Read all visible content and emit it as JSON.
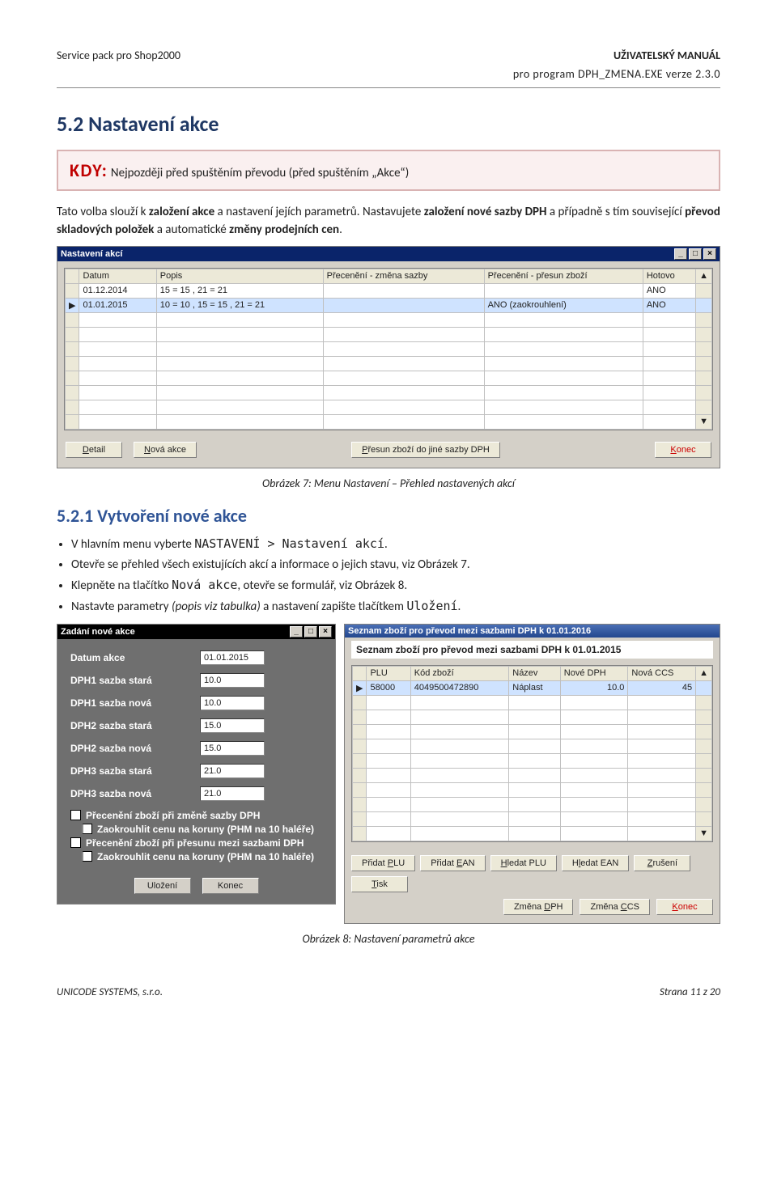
{
  "header": {
    "left": "Service pack pro Shop2000",
    "right_bold": "UŽIVATELSKÝ MANUÁL",
    "right_sub": "pro program DPH_ZMENA.EXE verze 2.3.0"
  },
  "h2": "5.2 Nastavení akce",
  "kdy": {
    "label": "KDY:",
    "text": "Nejpozději před spuštěním převodu (před spuštěním „Akce“)"
  },
  "para1_a": "Tato volba slouží k ",
  "para1_b": "založení akce",
  "para1_c": " a nastavení jejích parametrů. Nastavujete ",
  "para1_d": "založení nové sazby DPH",
  "para1_e": " a případně s tím související ",
  "para1_f": "převod skladových položek",
  "para1_g": " a automatické ",
  "para1_h": "změny prodejních cen",
  "para1_i": ".",
  "win1": {
    "title": "Nastavení akcí",
    "cols": [
      "Datum",
      "Popis",
      "Přecenění - změna sazby",
      "Přecenění - přesun zboží",
      "Hotovo"
    ],
    "rows": [
      {
        "datum": "01.12.2014",
        "popis": "15 = 15 , 21 = 21",
        "c3": "",
        "c4": "",
        "c5": "ANO"
      },
      {
        "datum": "01.01.2015",
        "popis": "10 = 10 , 15 = 15 , 21 = 21",
        "c3": "",
        "c4": "ANO (zaokrouhlení)",
        "c5": "ANO"
      }
    ],
    "btn_detail": "Detail",
    "btn_nova": "Nová akce",
    "btn_presun": "Přesun zboží do jiné sazby DPH",
    "btn_konec": "Konec"
  },
  "caption1": "Obrázek 7: Menu Nastavení – Přehled nastavených akcí",
  "h3": "5.2.1 Vytvoření nové akce",
  "bullets": [
    {
      "a": "V hlavním menu vyberte ",
      "m": "NASTAVENÍ > Nastavení akcí",
      "b": "."
    },
    {
      "a": "Otevře se přehled všech existujících akcí a informace o jejich stavu, viz Obrázek 7.",
      "m": "",
      "b": ""
    },
    {
      "a": "Klepněte na tlačítko ",
      "m": "Nová akce",
      "b": ", otevře se formulář, viz Obrázek 8."
    },
    {
      "a": "Nastavte parametry ",
      "i": "(popis viz tabulka)",
      "b": " a nastavení zapište tlačítkem ",
      "m": "Uložení",
      "c": "."
    }
  ],
  "form": {
    "title": "Zadání nové akce",
    "rows": [
      {
        "l": "Datum akce",
        "v": "01.01.2015"
      },
      {
        "l": "DPH1 sazba stará",
        "v": "10.0"
      },
      {
        "l": "DPH1 sazba nová",
        "v": "10.0"
      },
      {
        "l": "DPH2 sazba stará",
        "v": "15.0"
      },
      {
        "l": "DPH2 sazba nová",
        "v": "15.0"
      },
      {
        "l": "DPH3 sazba stará",
        "v": "21.0"
      },
      {
        "l": "DPH3 sazba nová",
        "v": "21.0"
      }
    ],
    "ck1": "Přecenění zboží při změně sazby DPH",
    "ck1b": "Zaokrouhlit cenu na koruny (PHM na 10 haléře)",
    "ck2": "Přecenění zboží při přesunu mezi sazbami DPH",
    "ck2b": "Zaokrouhlit cenu na koruny (PHM na 10 haléře)",
    "btn_save": "Uložení",
    "btn_konec": "Konec"
  },
  "seznam": {
    "title": "Seznam zboží pro převod mezi sazbami DPH k 01.01.2016",
    "subtitle": "Seznam zboží pro převod mezi sazbami DPH k 01.01.2015",
    "cols": [
      "PLU",
      "Kód zboží",
      "Název",
      "Nové DPH",
      "Nová CCS"
    ],
    "row": {
      "plu": "58000",
      "kod": "4049500472890",
      "nazev": "Náplast",
      "dph": "10.0",
      "ccs": "45"
    },
    "btns1": [
      "Přidat PLU",
      "Přidat EAN",
      "Hledat PLU",
      "Hledat EAN",
      "Zrušení",
      "Tisk"
    ],
    "btns2": [
      "Změna DPH",
      "Změna CCS",
      "Konec"
    ]
  },
  "caption2": "Obrázek 8: Nastavení parametrů akce",
  "footer": {
    "left": "UNICODE SYSTEMS, s.r.o.",
    "right": "Strana 11 z 20"
  }
}
